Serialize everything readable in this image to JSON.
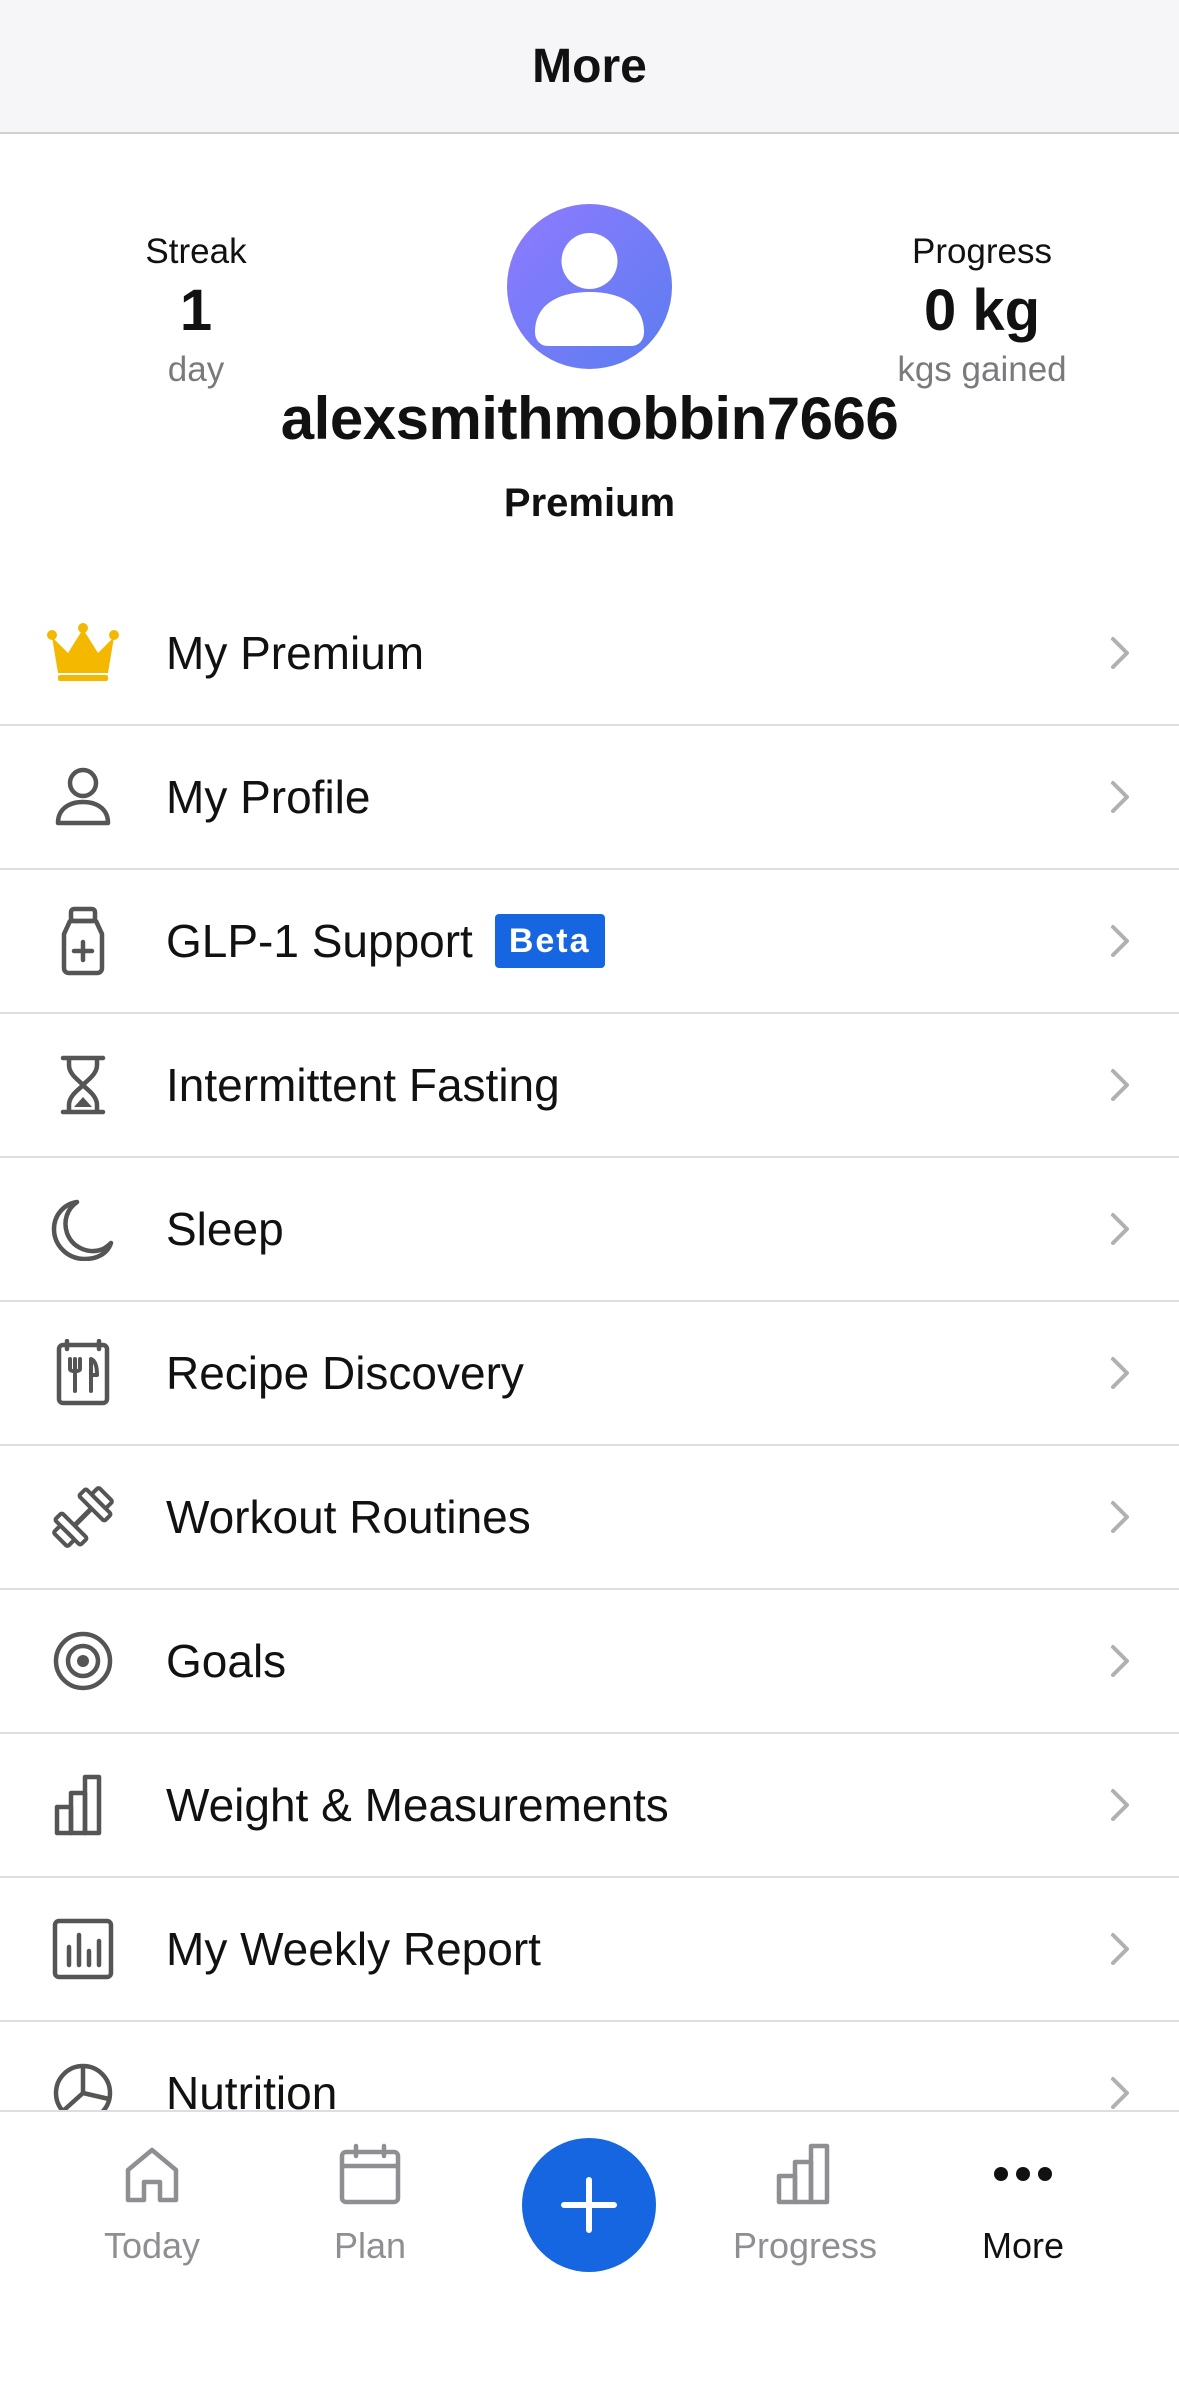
{
  "header": {
    "title": "More"
  },
  "profile": {
    "streak": {
      "label": "Streak",
      "value": "1",
      "unit": "day"
    },
    "progress": {
      "label": "Progress",
      "value": "0 kg",
      "unit": "kgs gained"
    },
    "username": "alexsmithmobbin7666",
    "plan": "Premium"
  },
  "menu": {
    "items": [
      {
        "label": "My Premium",
        "icon": "crown-icon"
      },
      {
        "label": "My Profile",
        "icon": "person-icon"
      },
      {
        "label": "GLP-1 Support",
        "badge": "Beta",
        "icon": "medicine-bottle-icon"
      },
      {
        "label": "Intermittent Fasting",
        "icon": "hourglass-icon"
      },
      {
        "label": "Sleep",
        "icon": "moon-icon"
      },
      {
        "label": "Recipe Discovery",
        "icon": "recipe-book-icon"
      },
      {
        "label": "Workout Routines",
        "icon": "dumbbell-icon"
      },
      {
        "label": "Goals",
        "icon": "target-icon"
      },
      {
        "label": "Weight & Measurements",
        "icon": "bar-chart-icon"
      },
      {
        "label": "My Weekly Report",
        "icon": "report-icon"
      },
      {
        "label": "Nutrition",
        "icon": "pie-chart-icon"
      }
    ]
  },
  "tabbar": {
    "tabs": [
      {
        "label": "Today",
        "icon": "home-icon"
      },
      {
        "label": "Plan",
        "icon": "calendar-icon"
      },
      {
        "label": "",
        "icon": "plus-icon"
      },
      {
        "label": "Progress",
        "icon": "bar-chart-icon"
      },
      {
        "label": "More",
        "icon": "more-icon"
      }
    ],
    "active": "More"
  },
  "colors": {
    "accent": "#1566e0",
    "crown": "#f5b800",
    "icon": "#555555",
    "secondary_text": "#8e8e93"
  }
}
